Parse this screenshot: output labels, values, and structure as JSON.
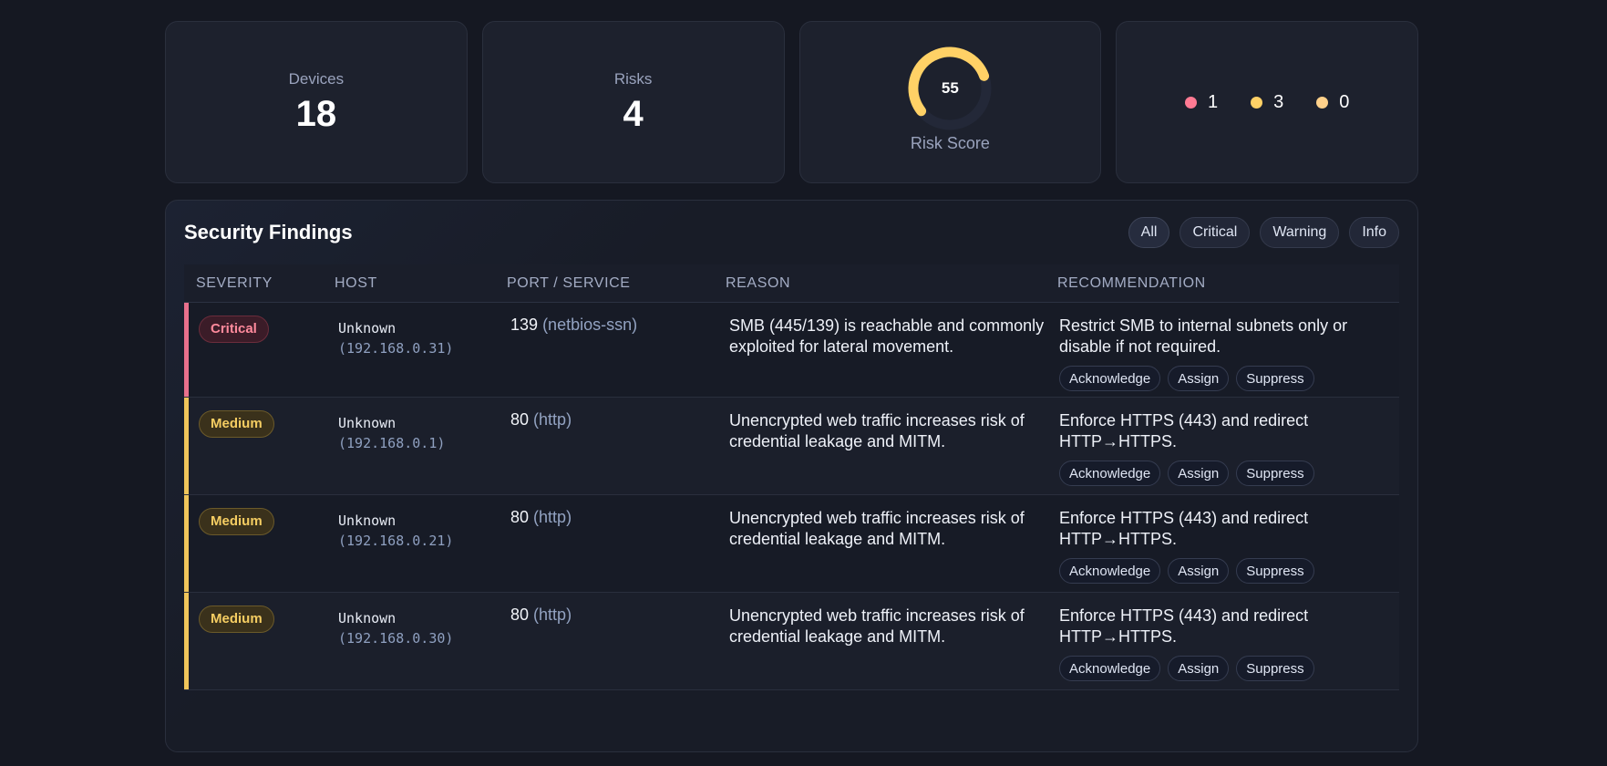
{
  "stats": {
    "devices": {
      "label": "Devices",
      "value": "18"
    },
    "risks": {
      "label": "Risks",
      "value": "4"
    },
    "risk_score": {
      "label": "Risk Score",
      "value": "55",
      "fraction": 0.55,
      "color": "#ffd166",
      "track_color": "#232838"
    },
    "legend": [
      {
        "value": "1",
        "color": "#ff7a93"
      },
      {
        "value": "3",
        "color": "#ffd166"
      },
      {
        "value": "0",
        "color": "#ffd18a"
      }
    ]
  },
  "findings": {
    "title": "Security Findings",
    "filters": [
      "All",
      "Critical",
      "Warning",
      "Info"
    ],
    "active_filter": "All",
    "columns": [
      "SEVERITY",
      "HOST",
      "PORT / SERVICE",
      "REASON",
      "RECOMMENDATION"
    ],
    "action_labels": [
      "Acknowledge",
      "Assign",
      "Suppress"
    ],
    "rows": [
      {
        "severity": "Critical",
        "severity_color": "#e8708c",
        "host_name": "Unknown",
        "host_ip": "(192.168.0.31)",
        "port": "139",
        "service": "(netbios-ssn)",
        "reason": "SMB (445/139) is reachable and commonly exploited for lateral movement.",
        "recommendation": "Restrict SMB to internal subnets only or disable if not required."
      },
      {
        "severity": "Medium",
        "severity_color": "#f0c55a",
        "host_name": "Unknown",
        "host_ip": "(192.168.0.1)",
        "port": "80",
        "service": "(http)",
        "reason": "Unencrypted web traffic increases risk of credential leakage and MITM.",
        "recommendation": "Enforce HTTPS (443) and redirect HTTP→HTTPS."
      },
      {
        "severity": "Medium",
        "severity_color": "#f0c55a",
        "host_name": "Unknown",
        "host_ip": "(192.168.0.21)",
        "port": "80",
        "service": "(http)",
        "reason": "Unencrypted web traffic increases risk of credential leakage and MITM.",
        "recommendation": "Enforce HTTPS (443) and redirect HTTP→HTTPS."
      },
      {
        "severity": "Medium",
        "severity_color": "#f0c55a",
        "host_name": "Unknown",
        "host_ip": "(192.168.0.30)",
        "port": "80",
        "service": "(http)",
        "reason": "Unencrypted web traffic increases risk of credential leakage and MITM.",
        "recommendation": "Enforce HTTPS (443) and redirect HTTP→HTTPS."
      }
    ]
  }
}
